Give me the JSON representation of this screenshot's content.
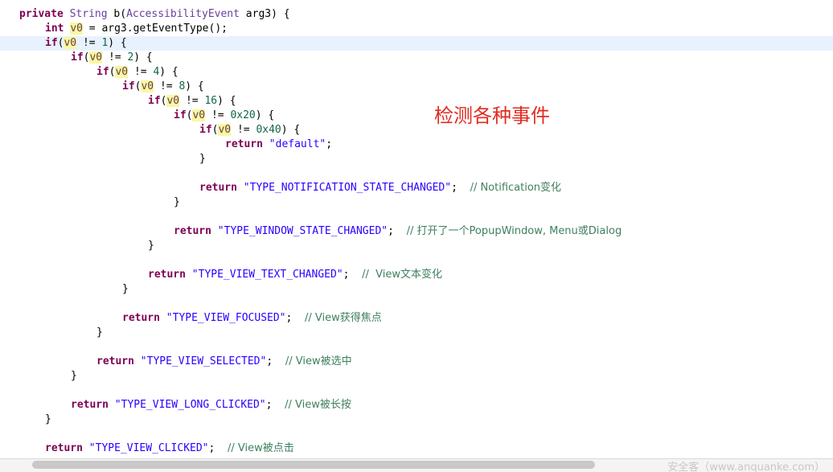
{
  "code": {
    "method_signature": {
      "kw_private": "private",
      "type_string": "String",
      "method_name": "b(",
      "param_type": "AccessibilityEvent",
      "param_name": " arg3) {"
    },
    "line2": {
      "kw": "int",
      "var": "v0",
      "rest": " = arg3.getEventType();"
    },
    "line3": {
      "kw": "if",
      "open": "(",
      "var": "v0",
      "op": " != ",
      "num": "1",
      "close": ") {"
    },
    "line4": {
      "kw": "if",
      "open": "(",
      "var": "v0",
      "op": " != ",
      "num": "2",
      "close": ") {"
    },
    "line5": {
      "kw": "if",
      "open": "(",
      "var": "v0",
      "op": " != ",
      "num": "4",
      "close": ") {"
    },
    "line6": {
      "kw": "if",
      "open": "(",
      "var": "v0",
      "op": " != ",
      "num": "8",
      "close": ") {"
    },
    "line7": {
      "kw": "if",
      "open": "(",
      "var": "v0",
      "op": " != ",
      "num": "16",
      "close": ") {"
    },
    "line8": {
      "kw": "if",
      "open": "(",
      "var": "v0",
      "op": " != ",
      "num": "0x20",
      "close": ") {"
    },
    "line9": {
      "kw": "if",
      "open": "(",
      "var": "v0",
      "op": " != ",
      "num": "0x40",
      "close": ") {"
    },
    "line10": {
      "kw": "return",
      "str": "\"default\"",
      "end": ";"
    },
    "brace": "}",
    "returns": [
      {
        "kw": "return",
        "str": "\"TYPE_NOTIFICATION_STATE_CHANGED\"",
        "end": ";  ",
        "comment": "// Notification变化"
      },
      {
        "kw": "return",
        "str": "\"TYPE_WINDOW_STATE_CHANGED\"",
        "end": ";  ",
        "comment": "// 打开了一个PopupWindow, Menu或Dialog"
      },
      {
        "kw": "return",
        "str": "\"TYPE_VIEW_TEXT_CHANGED\"",
        "end": ";  ",
        "comment": "//  View文本变化"
      },
      {
        "kw": "return",
        "str": "\"TYPE_VIEW_FOCUSED\"",
        "end": ";  ",
        "comment": "// View获得焦点"
      },
      {
        "kw": "return",
        "str": "\"TYPE_VIEW_SELECTED\"",
        "end": ";  ",
        "comment": "// View被选中"
      },
      {
        "kw": "return",
        "str": "\"TYPE_VIEW_LONG_CLICKED\"",
        "end": ";  ",
        "comment": "// View被长按"
      },
      {
        "kw": "return",
        "str": "\"TYPE_VIEW_CLICKED\"",
        "end": ";  ",
        "comment": "// View被点击"
      }
    ]
  },
  "annotation": "检测各种事件",
  "watermark": "安全客（www.anquanke.com）",
  "colors": {
    "keyword": "#7f0055",
    "string": "#2a00ff",
    "comment": "#3f7f5f",
    "number": "#116644",
    "variable_highlight": "#f7f7a5",
    "current_line": "#e8f2fe",
    "annotation": "#e02b20"
  }
}
